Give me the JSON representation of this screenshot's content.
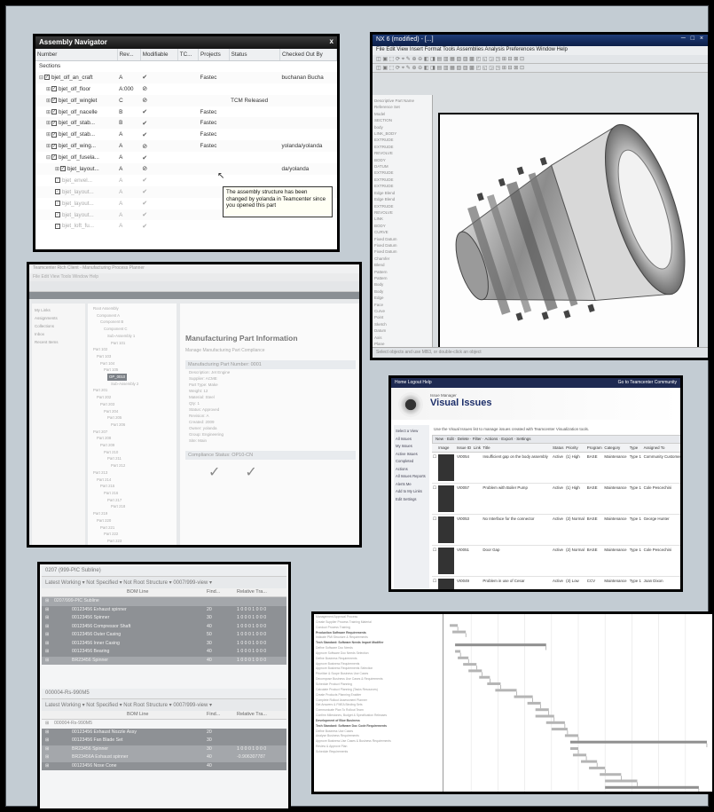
{
  "assembly_navigator": {
    "title": "Assembly Navigator",
    "close": "x",
    "columns": [
      "Number",
      "Rev...",
      "Modifiable",
      "TC...",
      "Projects",
      "Status",
      "Checked Out By"
    ],
    "rows": [
      {
        "number": "Sections",
        "rev": "",
        "mod": "",
        "proj": "",
        "status": "",
        "checked": ""
      },
      {
        "number": "bjet_olf_an_craft",
        "rev": "A",
        "mod": "✔",
        "proj": "Fastec",
        "status": "",
        "checked": "buchanan Bucha"
      },
      {
        "number": "bjet_olf_floor",
        "rev": "A:000",
        "mod": "⊘",
        "proj": "",
        "status": "",
        "checked": ""
      },
      {
        "number": "bjet_olf_winglet",
        "rev": "C",
        "mod": "⊘",
        "proj": "",
        "status": "TCM Released",
        "checked": ""
      },
      {
        "number": "bjet_olf_nacelle",
        "rev": "B",
        "mod": "✔",
        "proj": "Fastec",
        "status": "",
        "checked": ""
      },
      {
        "number": "bjet_olf_stab...",
        "rev": "B",
        "mod": "✔",
        "proj": "Fastec",
        "status": "",
        "checked": ""
      },
      {
        "number": "bjet_olf_stab...",
        "rev": "A",
        "mod": "✔",
        "proj": "Fastec",
        "status": "",
        "checked": ""
      },
      {
        "number": "bjet_olf_wing...",
        "rev": "A",
        "mod": "⊘",
        "proj": "Fastec",
        "status": "",
        "checked": "yolanda/yolanda"
      },
      {
        "number": "bjet_olf_fusela...",
        "rev": "A",
        "mod": "✔",
        "proj": "",
        "status": "",
        "checked": ""
      },
      {
        "number": "bjet_layout...",
        "rev": "A",
        "mod": "⊘",
        "proj": "",
        "status": "",
        "checked": "da/yolanda"
      },
      {
        "number": "bjet_envel...",
        "rev": "A",
        "mod": "✔",
        "proj": "",
        "status": "",
        "checked": ""
      },
      {
        "number": "bjet_layout...",
        "rev": "A",
        "mod": "✔",
        "proj": "",
        "status": "",
        "checked": ""
      },
      {
        "number": "bjet_layout...",
        "rev": "A",
        "mod": "✔",
        "proj": "",
        "status": "",
        "checked": ""
      },
      {
        "number": "bjet_layout...",
        "rev": "A",
        "mod": "✔",
        "proj": "",
        "status": "",
        "checked": ""
      },
      {
        "number": "bjet_loft_fu...",
        "rev": "A",
        "mod": "✔",
        "proj": "",
        "status": "",
        "checked": ""
      }
    ],
    "tooltip": "The assembly structure has been changed by yolanda in Teamcenter since you opened this part"
  },
  "cad_window": {
    "title": "NX 6 (modified) - [...]",
    "title_right": "─ □ ×",
    "menu": "File  Edit  View  Insert  Format  Tools  Assemblies  Analysis  Preferences  Window  Help",
    "toolbar": "◫ ▣ ⬚ ⟳ ⌖ ✎ ⊕ ⊖ ◧ ◨ ▤ ▥ ▦ ▧ ▨ ▩ ◰ ◱ ◲ ◳ ⊞ ⊟ ⊠ ⊡",
    "nav_items": [
      "Descriptive Part Name",
      "Reference Set",
      "Model",
      "SECTION",
      "body",
      "LINK_BODY",
      "EXTRUDE",
      "EXTRUDE",
      "REVOLVE",
      "BODY",
      "DATUM",
      "EXTRUDE",
      "EXTRUDE",
      "EXTRUDE",
      "Edge Blend",
      "Edge Blend",
      "EXTRUDE",
      "REVOLVE",
      "LINK",
      "BODY",
      "CURVE",
      "Fixed Datum",
      "Fixed Datum",
      "Fixed Datum",
      "Chamfer",
      "Blend",
      "Pattern",
      "Pattern",
      "Body",
      "Body",
      "Edge",
      "Face",
      "Curve",
      "Point",
      "Sketch",
      "Datum",
      "Axis",
      "Plane"
    ],
    "status": "Select objects and use MB3, or double-click an object"
  },
  "manufacturing": {
    "window_title": "Teamcenter Rich Client - Manufacturing Process Planner",
    "menu": "File  Edit  View  Tools  Window  Help",
    "left_items": [
      "My Links",
      "Assignments",
      "Collections",
      "Inbox",
      "Recent Items"
    ],
    "tree_items": [
      "Root Assembly",
      "Component A",
      "Component B",
      "Component C",
      "Sub-Assembly 1",
      "Part 101",
      "Part 102",
      "Part 103",
      "Part 104",
      "Part 105",
      "Selected Item",
      "Sub-Assembly 2",
      "Part 201",
      "Part 202",
      "Part 203",
      "Part 204",
      "Part 205",
      "Part 206",
      "Part 207",
      "Part 208",
      "Part 209",
      "Part 210",
      "Part 211",
      "Part 212",
      "Part 213",
      "Part 214",
      "Part 215",
      "Part 216",
      "Part 217",
      "Part 218",
      "Part 219",
      "Part 220",
      "Part 221",
      "Part 222",
      "Part 223"
    ],
    "selected": "OP_0010",
    "heading": "Manufacturing Part Information",
    "subheading": "Manage Manufacturing Part Compliance",
    "section1": "Manufacturing Part Number: 0001",
    "kv_lines": [
      "Description:  Jet Engine",
      "Supplier:  ACME",
      "Part Type:  Make",
      "Weight:  12",
      "Material:  Steel",
      "Qty:  1",
      "Status:  Approved",
      "Revision:  A",
      "Created:  2009",
      "Owner:  yolanda",
      "Group:  Engineering",
      "Site:  Main"
    ],
    "section2": "Compliance Status: OP10-CN",
    "compliance_cols": [
      "Status",
      "Approval",
      "Approval"
    ]
  },
  "visual_issues": {
    "nav_left": "Home  Logout  Help",
    "nav_right": "Go to Teamcenter Community",
    "title": "Visual Issues",
    "suite": "Issue Manager",
    "description": "Use the Visual Issues list to manage issues created with Teamcenter Visualization tools.",
    "toolbar": "New  ·  Edit  ·  Delete  ·  Filter  ·  Actions  ·  Export  ·  Settings",
    "side_items": [
      "Select a View",
      "All Issues",
      "My Issues",
      "Active Issues",
      "Completed",
      "Actions",
      "All Issues Reports",
      "Alerts Me",
      "Add to My Links",
      "Edit Settings"
    ],
    "columns": [
      "",
      "Image",
      "Issue ID",
      "Link",
      "Title",
      "Status",
      "Priority",
      "Program",
      "Category",
      "Type",
      "Assigned To"
    ],
    "rows": [
      {
        "id": "VI0054",
        "title": "Insufficient gap on the body assembly",
        "status": "Active",
        "priority": "(1) High",
        "program": "BASE",
        "category": "Maintenance",
        "type": "Type 1",
        "assigned": "Community Customer"
      },
      {
        "id": "VI0057",
        "title": "Problem with Boiler Pump",
        "status": "Active",
        "priority": "(1) High",
        "program": "BASE",
        "category": "Maintenance",
        "type": "Type 1",
        "assigned": "Cole Pescechini"
      },
      {
        "id": "VI0053",
        "title": "No Interface for the connector",
        "status": "Active",
        "priority": "(2) Normal",
        "program": "BASE",
        "category": "Maintenance",
        "type": "Type 1",
        "assigned": "George Hunter"
      },
      {
        "id": "VI0051",
        "title": "Door Gap",
        "status": "Active",
        "priority": "(2) Normal",
        "program": "BASE",
        "category": "Maintenance",
        "type": "Type 1",
        "assigned": "Cole Pescechini"
      },
      {
        "id": "VI0049",
        "title": "Problem in use of Cesar",
        "status": "Active",
        "priority": "(3) Low",
        "program": "CCV",
        "category": "Maintenance",
        "type": "Type 1",
        "assigned": "Joan Dixon"
      }
    ]
  },
  "bom": {
    "pane1_title": "0207 (999-PIC Subline)",
    "pane2_title": "000004-Rs-990M5",
    "filter": "Latest Working  ▾   Not Specified  ▾   Not Root Structure  ▾   0007/999-view ▾",
    "columns": [
      "BOM Line",
      "Find...",
      "Relative Tra..."
    ],
    "rows1": [
      {
        "line": "0207/999-PIC Subline",
        "find": "",
        "rel": "",
        "style": "gray"
      },
      {
        "line": "00123456 Exhaust spinner",
        "find": "20",
        "rel": "1 0 0 0 1 0 0 0",
        "style": "dark"
      },
      {
        "line": "00123456 Spinner",
        "find": "30",
        "rel": "1 0 0 0 1 0 0 0",
        "style": "dark"
      },
      {
        "line": "00123456 Compressor Shaft",
        "find": "40",
        "rel": "1 0 0 0 1 0 0 0",
        "style": "dark"
      },
      {
        "line": "00123456 Outer Casing",
        "find": "50",
        "rel": "1 0 0 0 1 0 0 0",
        "style": "dark"
      },
      {
        "line": "00123456 Inner Casing",
        "find": "30",
        "rel": "1 0 0 0 1 0 0 0",
        "style": "dark"
      },
      {
        "line": "00123456 Bearing",
        "find": "40",
        "rel": "1 0 0 0 1 0 0 0",
        "style": "dark"
      },
      {
        "line": "BR23456 Spinner",
        "find": "40",
        "rel": "1 0 0 0 1 0 0 0",
        "style": "gray"
      }
    ],
    "rows2": [
      {
        "line": "000004-Rs-990M5",
        "find": "",
        "rel": "",
        "style": ""
      },
      {
        "line": "00123456 Exhaust Nozzle Assy",
        "find": "20",
        "rel": "",
        "style": "dark"
      },
      {
        "line": "00123456 Fan Blade Set",
        "find": "30",
        "rel": "",
        "style": "dark"
      },
      {
        "line": "BR23456 Spinner",
        "find": "30",
        "rel": "1 0 0 0 1 0 0 0",
        "style": "gray"
      },
      {
        "line": "BR23456A Exhaust spinner",
        "find": "40",
        "rel": "-0.906307787",
        "style": "gray"
      },
      {
        "line": "00123456 Nose Cone",
        "find": "40",
        "rel": "",
        "style": "dark"
      }
    ]
  },
  "gantt": {
    "tasks": [
      "Management Approval Process",
      "Create Supplier Process Training Material",
      "Conduct Process Training",
      "Production Software Requirements",
      "Indicate PMI Structure & Requirements",
      "Tech Standard: Software Needs Import Modifier",
      "Define Software Doc Needs",
      "Approve Software Doc Needs Selection",
      "Define Business Requirements",
      "Approve Business Requirements",
      "Approve Business Requirements Selection",
      "Prioritize & Scope Business Use Cases",
      "Decompose Business Use Cases & Requirements",
      "Schedule Product Planning",
      "Calculate Product Planning (Tasks Resources)",
      "Create Products Planning Enabler",
      "Complete Rollout Assessment Planner",
      "Get Answers & FMEA Binding Sets",
      "Communicate Plan To Rollout Team",
      "Confirm Milestones, Budget & Specification Releases",
      "Development of Blue Business",
      "Tech Standard: Software Doc Code Requirements",
      "Define Business Use Cases",
      "Analyse Business Requirements",
      "Approve Business Use Cases & Business Requirements",
      "Review & Approve Plan",
      "Schedule Requirements"
    ],
    "bold_indices": [
      3,
      5,
      20,
      21
    ],
    "bars": [
      {
        "row": 1,
        "start": 0.02,
        "end": 0.05
      },
      {
        "row": 2,
        "start": 0.03,
        "end": 0.08
      },
      {
        "row": 4,
        "start": 0.04,
        "end": 0.38
      },
      {
        "row": 5,
        "start": 0.04,
        "end": 0.06
      },
      {
        "row": 6,
        "start": 0.05,
        "end": 0.09
      },
      {
        "row": 7,
        "start": 0.07,
        "end": 0.12
      },
      {
        "row": 8,
        "start": 0.09,
        "end": 0.14
      },
      {
        "row": 9,
        "start": 0.13,
        "end": 0.17
      },
      {
        "row": 10,
        "start": 0.16,
        "end": 0.21
      },
      {
        "row": 11,
        "start": 0.19,
        "end": 0.27
      },
      {
        "row": 12,
        "start": 0.26,
        "end": 0.33
      },
      {
        "row": 13,
        "start": 0.31,
        "end": 0.36
      },
      {
        "row": 14,
        "start": 0.34,
        "end": 0.39
      },
      {
        "row": 15,
        "start": 0.34,
        "end": 0.41
      },
      {
        "row": 16,
        "start": 0.38,
        "end": 0.45
      },
      {
        "row": 17,
        "start": 0.4,
        "end": 0.46
      },
      {
        "row": 18,
        "start": 0.45,
        "end": 0.5
      },
      {
        "row": 19,
        "start": 0.47,
        "end": 0.98
      },
      {
        "row": 20,
        "start": 0.47,
        "end": 0.5
      },
      {
        "row": 21,
        "start": 0.48,
        "end": 0.53
      },
      {
        "row": 22,
        "start": 0.51,
        "end": 0.57
      },
      {
        "row": 23,
        "start": 0.54,
        "end": 0.6
      },
      {
        "row": 24,
        "start": 0.58,
        "end": 0.66
      },
      {
        "row": 25,
        "start": 0.6,
        "end": 0.72
      },
      {
        "row": 26,
        "start": 0.6,
        "end": 0.95
      }
    ]
  }
}
